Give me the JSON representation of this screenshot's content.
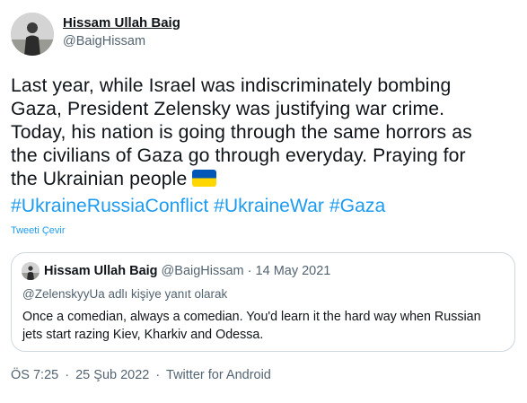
{
  "author": {
    "name": "Hissam Ullah Baig",
    "handle": "@BaigHissam"
  },
  "tweet": {
    "lines": [
      "Last year, while Israel was indiscriminately bombing",
      "Gaza, President Zelensky was justifying war crime.",
      "Today, his nation is  going through the same horrors as",
      "the civilians of Gaza go through everyday. Praying for",
      "the Ukrainian people"
    ],
    "flag_icon": "ukraine-flag-emoji",
    "hashtags": [
      "#UkraineRussiaConflict",
      "#UkraineWar",
      "#Gaza"
    ],
    "translate_label": "Tweeti Çevir"
  },
  "quoted_tweet": {
    "name": "Hissam Ullah Baig",
    "handle": "@BaigHissam",
    "separator": "·",
    "date": "14 May 2021",
    "reply_context": "@ZelenskyyUa adlı kişiye yanıt olarak",
    "lines": [
      "Once a comedian, always a comedian. You'd learn it the hard way when Russian",
      "jets start razing Kiev, Kharkiv and Odessa."
    ]
  },
  "footer": {
    "time": "ÖS 7:25",
    "separator": "·",
    "date": "25 Şub 2022",
    "source": "Twitter for Android"
  },
  "colors": {
    "link": "#1d9bf0",
    "secondary_text": "#536471",
    "primary_text": "#0f1419",
    "border": "#cfd9de",
    "flag_blue": "#0057b7",
    "flag_yellow": "#ffd700"
  }
}
